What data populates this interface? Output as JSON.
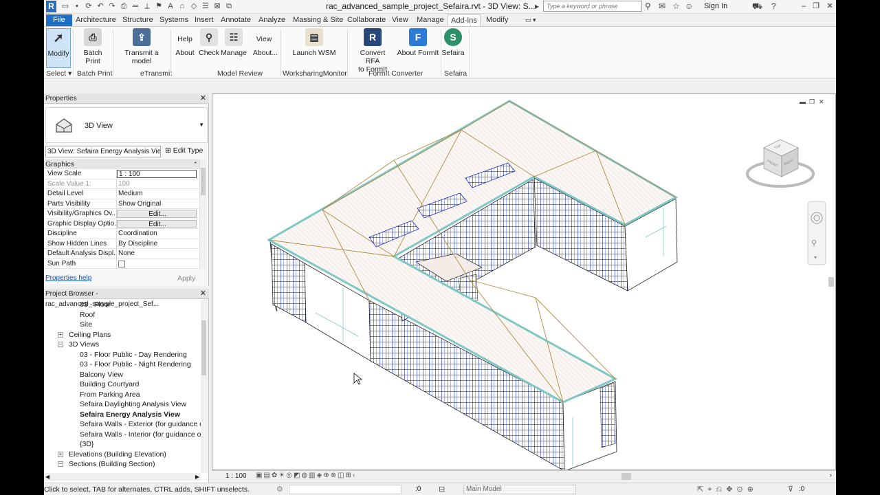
{
  "window": {
    "title": "rac_advanced_sample_project_Sefaira.rvt - 3D View: S...",
    "search_placeholder": "Type a keyword or phrase",
    "sign_in": "Sign In"
  },
  "tabs": [
    {
      "label": "File"
    },
    {
      "label": "Architecture"
    },
    {
      "label": "Structure"
    },
    {
      "label": "Systems"
    },
    {
      "label": "Insert"
    },
    {
      "label": "Annotate"
    },
    {
      "label": "Analyze"
    },
    {
      "label": "Massing & Site"
    },
    {
      "label": "Collaborate"
    },
    {
      "label": "View"
    },
    {
      "label": "Manage"
    },
    {
      "label": "Add-Ins"
    },
    {
      "label": "Modify"
    }
  ],
  "ribbon": {
    "modify": "Modify",
    "select": "Select",
    "batch_print": "Batch Print",
    "batch_print_panel": "Batch Print",
    "transmit": "Transmit a model",
    "etransmit_panel": "eTransmit",
    "help": "Help",
    "about": "About",
    "check": "Check",
    "manage": "Manage",
    "view": "View",
    "about2": "About...",
    "model_review_panel": "Model Review",
    "launch_wsm": "Launch WSM",
    "wsm_panel": "WorksharingMonitor",
    "convert_rfa_1": "Convert RFA",
    "convert_rfa_2": "to FormIt",
    "about_formit": "About FormIt",
    "formit_panel": "FormIt Converter",
    "sefaira": "Sefaira",
    "sefaira_panel": "Sefaira"
  },
  "properties": {
    "title": "Properties",
    "type_name": "3D View",
    "view_selector": "3D View: Sefaira Energy Analysis Vie",
    "edit_type": "Edit Type",
    "group": "Graphics",
    "rows": [
      {
        "key": "View Scale",
        "value": "1 : 100"
      },
      {
        "key": "Scale Value    1:",
        "value": "100"
      },
      {
        "key": "Detail Level",
        "value": "Medium"
      },
      {
        "key": "Parts Visibility",
        "value": "Show Original"
      },
      {
        "key": "Visibility/Graphics Ov...",
        "value": "Edit..."
      },
      {
        "key": "Graphic Display Optio...",
        "value": "Edit..."
      },
      {
        "key": "Discipline",
        "value": "Coordination"
      },
      {
        "key": "Show Hidden Lines",
        "value": "By Discipline"
      },
      {
        "key": "Default Analysis Displ...",
        "value": "None"
      },
      {
        "key": "Sun Path",
        "value": ""
      }
    ],
    "help": "Properties help",
    "apply": "Apply"
  },
  "browser": {
    "title": "Project Browser - rac_advanced_sample_project_Sef...",
    "nodes": [
      {
        "label": "03 - Floor"
      },
      {
        "label": "Roof"
      },
      {
        "label": "Site"
      },
      {
        "label": "Ceiling Plans"
      },
      {
        "label": "3D Views"
      },
      {
        "label": "03 - Floor Public - Day Rendering"
      },
      {
        "label": "03 - Floor Public - Night Rendering"
      },
      {
        "label": "Balcony View"
      },
      {
        "label": "Building Courtyard"
      },
      {
        "label": "From Parking Area"
      },
      {
        "label": "Sefaira Daylighting Analysis View"
      },
      {
        "label": "Sefaira Energy Analysis View"
      },
      {
        "label": "Sefaira Walls - Exterior (for guidance only"
      },
      {
        "label": "Sefaira Walls - Interior (for guidance only"
      },
      {
        "label": "{3D}"
      },
      {
        "label": "Elevations (Building Elevation)"
      },
      {
        "label": "Sections (Building Section)"
      }
    ]
  },
  "viewcube": {
    "top": "TOP",
    "front": "FRONT",
    "right": "RIGHT"
  },
  "viewbar": {
    "scale": "1 : 100"
  },
  "status": {
    "message": "Click to select, TAB for alternates, CTRL adds, SHIFT unselects.",
    "count1": ":0",
    "model": "Main Model",
    "count2": ":0"
  },
  "colors": {
    "accent": "#1f6fc3",
    "wall_blue": "#1a2fd0",
    "roof_tan": "#b08a3e",
    "parapet_teal": "#7fc7c5"
  }
}
